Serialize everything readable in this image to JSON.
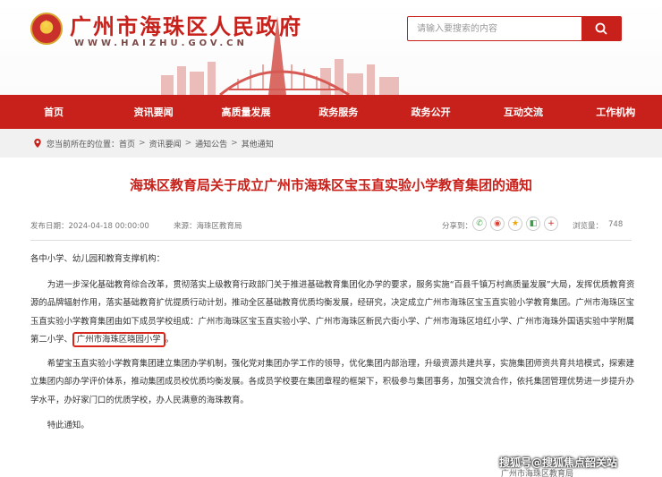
{
  "header": {
    "site_title": "广州市海珠区人民政府",
    "site_url": "WWW.HAIZHU.GOV.CN",
    "search_placeholder": "请输入要搜索的内容"
  },
  "nav": {
    "items": [
      "首页",
      "资讯要闻",
      "高质量发展",
      "政务服务",
      "政务公开",
      "互动交流",
      "工作机构"
    ]
  },
  "breadcrumb": {
    "prefix": "您当前所在的位置：",
    "items": [
      "首页",
      "资讯要闻",
      "通知公告",
      "其他通知"
    ],
    "separator": ">"
  },
  "article": {
    "title": "海珠区教育局关于成立广州市海珠区宝玉直实验小学教育集团的通知",
    "meta": {
      "date": "发布日期：2024-04-18 00:00:00",
      "source": "来源：海珠区教育局",
      "share_label": "分享到：",
      "views_label": "浏览量：",
      "views": "748"
    },
    "greeting": "各中小学、幼儿园和教育支撑机构：",
    "para1_text": "为进一步深化基础教育综合改革，贯彻落实上级教育行政部门关于推进基础教育集团化办学的要求，服务实施“百县千镇万村高质量发展”大局，发挥优质教育资源的品牌辐射作用，落实基础教育扩优提质行动计划，推动全区基础教育优质均衡发展，经研究，决定成立广州市海珠区宝玉直实验小学教育集团。广州市海珠区宝玉直实验小学教育集团由如下成员学校组成：广州市海珠区宝玉直实验小学、广州市海珠区新民六街小学、广州市海珠区培红小学、广州市海珠外国语实验中学附属第二小学、",
    "highlight": "广州市海珠区晓园小学",
    "para1_end": "。",
    "para2": "希望宝玉直实验小学教育集团建立集团办学机制，强化党对集团办学工作的领导，优化集团内部治理，升级资源共建共享，实施集团师资共育共培模式，探索建立集团内部办学评价体系，推动集团成员校优质均衡发展。各成员学校要在集团章程的框架下，积极参与集团事务，加强交流合作，依托集团管理优势进一步提升办学水平，办好家门口的优质学校，办人民满意的海珠教育。",
    "closing": "特此通知。",
    "signature": "广州市海珠区教育局"
  },
  "watermark": "搜狐号@搜狐焦点韶关站",
  "colors": {
    "brand_red": "#c8211b",
    "breadcrumb_bg": "#f1f1f1"
  }
}
